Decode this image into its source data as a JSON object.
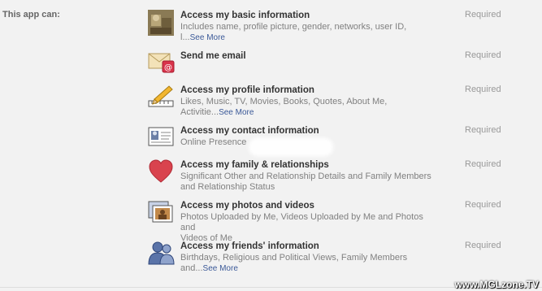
{
  "label": "This app can:",
  "required_label": "Required",
  "see_more": "See More",
  "watermark": "www.MGLzone.TV",
  "permissions": [
    {
      "title": "Access my basic information",
      "desc1": "Includes name, profile picture, gender, networks, user ID,",
      "desc2": "l...",
      "see_more": true,
      "icon": "profile-photo-icon"
    },
    {
      "title": "Send me email",
      "desc1": "",
      "desc2": "",
      "see_more": false,
      "icon": "email-icon"
    },
    {
      "title": "Access my profile information",
      "desc1": "Likes, Music, TV, Movies, Books, Quotes, About Me,",
      "desc2": "Activitie...",
      "see_more": true,
      "icon": "pencil-ruler-icon"
    },
    {
      "title": "Access my contact information",
      "desc1": "Online Presence",
      "desc2": "",
      "see_more": false,
      "icon": "contact-card-icon"
    },
    {
      "title": "Access my family & relationships",
      "desc1": "Significant Other and Relationship Details and Family Members",
      "desc2": "and Relationship Status",
      "see_more": false,
      "icon": "heart-icon"
    },
    {
      "title": "Access my photos and videos",
      "desc1": "Photos Uploaded by Me, Videos Uploaded by Me and Photos and",
      "desc2": "Videos of Me",
      "see_more": false,
      "icon": "photos-icon"
    },
    {
      "title": "Access my friends' information",
      "desc1": "Birthdays, Religious and Political Views, Family Members",
      "desc2": "and...",
      "see_more": true,
      "icon": "friends-icon"
    }
  ]
}
